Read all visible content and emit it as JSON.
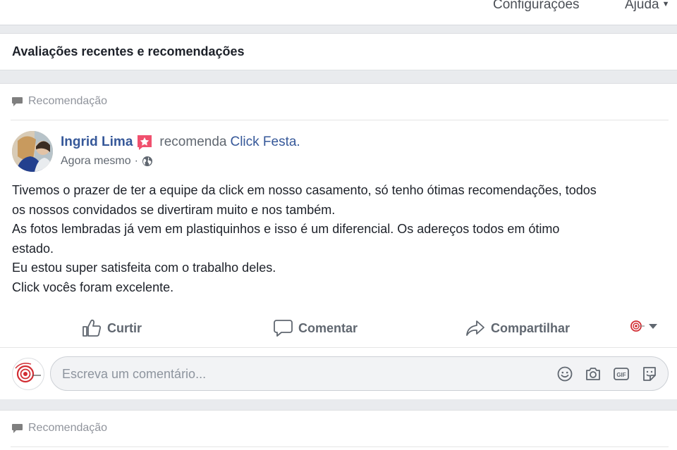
{
  "topbar": {
    "settings": "Configurações",
    "help": "Ajuda"
  },
  "section": {
    "title": "Avaliações recentes e recomendações"
  },
  "post": {
    "label": "Recomendação",
    "author": "Ingrid Lima",
    "verb": "recomenda",
    "page": "Click Festa.",
    "time": "Agora mesmo",
    "separator": "·",
    "body": [
      "Tivemos o prazer de ter a equipe da click em nosso casamento, só tenho ótimas recomendações, todos",
      "os nossos convidados se divertiram muito e nos também.",
      "As fotos lembradas já vem em plastiquinhos e isso é um diferencial. Os adereços todos em ótimo",
      "estado.",
      "Eu estou super satisfeita com o trabalho deles.",
      "Click vocês foram excelente."
    ],
    "actions": {
      "like": "Curtir",
      "comment": "Comentar",
      "share": "Compartilhar"
    }
  },
  "comment": {
    "placeholder": "Escreva um comentário..."
  },
  "post2": {
    "label": "Recomendação"
  },
  "icons": [
    "speech-bubble-icon",
    "recommend-star-icon",
    "globe-icon",
    "thumbs-up-icon",
    "comment-icon",
    "share-icon",
    "page-logo-icon",
    "emoji-icon",
    "camera-icon",
    "gif-icon",
    "sticker-icon"
  ],
  "colors": {
    "link": "#365899",
    "muted": "#606770",
    "background": "#e9ebee",
    "badge": "#f0506e"
  }
}
